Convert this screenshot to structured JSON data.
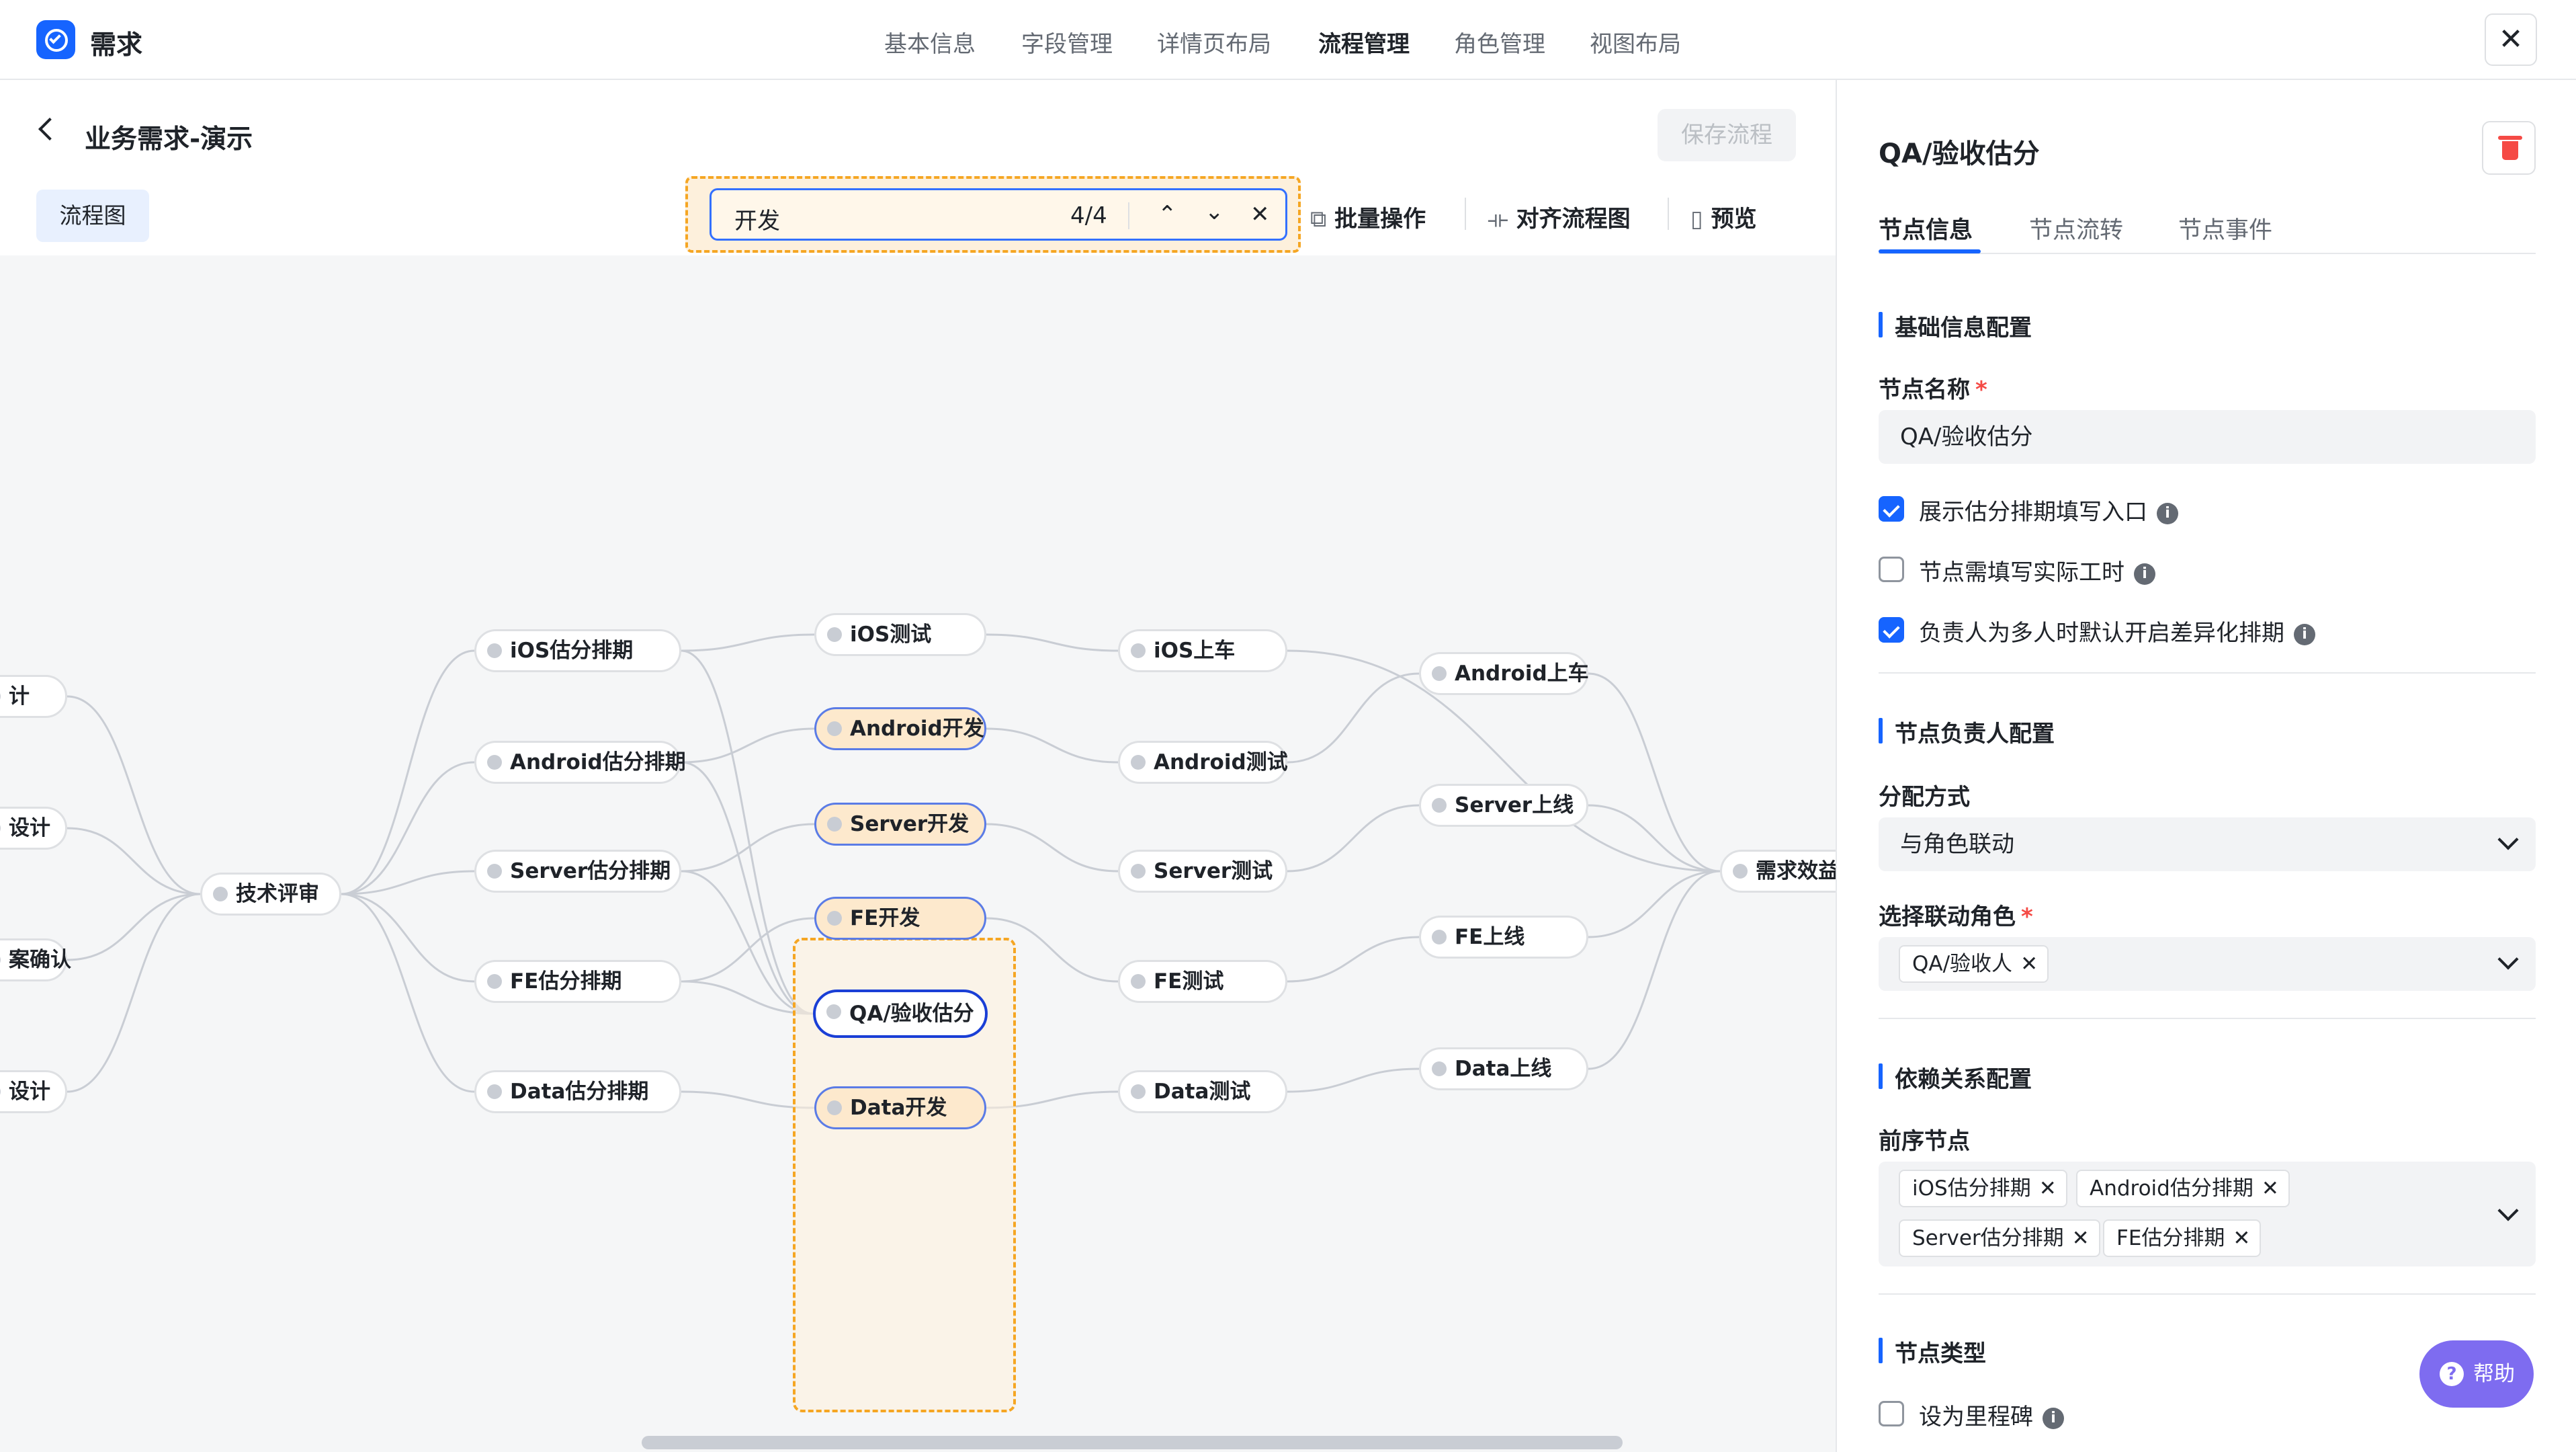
{
  "app": {
    "title": "需求"
  },
  "nav": {
    "tabs": [
      "基本信息",
      "字段管理",
      "详情页布局",
      "流程管理",
      "角色管理",
      "视图布局"
    ],
    "active": "流程管理"
  },
  "header": {
    "title": "业务需求-演示",
    "save_label": "保存流程",
    "view_tab": "流程图"
  },
  "search": {
    "value": "开发",
    "count": "4/4"
  },
  "toolbar": {
    "batch": "批量操作",
    "align": "对齐流程图",
    "preview": "预览"
  },
  "flow": {
    "nodes": {
      "left1": "计",
      "left2": "设计",
      "left3": "案确认",
      "left4": "设计",
      "review": "技术评审",
      "ios_est": "iOS估分排期",
      "android_est": "Android估分排期",
      "server_est": "Server估分排期",
      "fe_est": "FE估分排期",
      "data_est": "Data估分排期",
      "ios_test": "iOS测试",
      "android_dev": "Android开发",
      "server_dev": "Server开发",
      "fe_dev": "FE开发",
      "qa_est": "QA/验收估分",
      "data_dev": "Data开发",
      "ios_release": "iOS上车",
      "android_test": "Android测试",
      "server_test": "Server测试",
      "fe_test": "FE测试",
      "data_test": "Data测试",
      "android_release": "Android上车",
      "server_release": "Server上线",
      "fe_release": "FE上线",
      "data_release": "Data上线",
      "benefit": "需求效益"
    }
  },
  "panel": {
    "title": "QA/验收估分",
    "tabs": [
      "节点信息",
      "节点流转",
      "节点事件"
    ],
    "basic_section": "基础信息配置",
    "name_label": "节点名称",
    "name_value": "QA/验收估分",
    "checks": [
      {
        "label": "展示估分排期填写入口",
        "checked": true
      },
      {
        "label": "节点需填写实际工时",
        "checked": false
      },
      {
        "label": "负责人为多人时默认开启差异化排期",
        "checked": true
      }
    ],
    "owner_section": "节点负责人配置",
    "assign_label": "分配方式",
    "assign_value": "与角色联动",
    "role_label": "选择联动角色",
    "role_chip": "QA/验收人",
    "dep_section": "依赖关系配置",
    "pre_label": "前序节点",
    "pre_chips": [
      "iOS估分排期",
      "Android估分排期",
      "Server估分排期",
      "FE估分排期"
    ],
    "type_section": "节点类型",
    "milestone_label": "设为里程碑"
  },
  "help": {
    "label": "帮助"
  }
}
